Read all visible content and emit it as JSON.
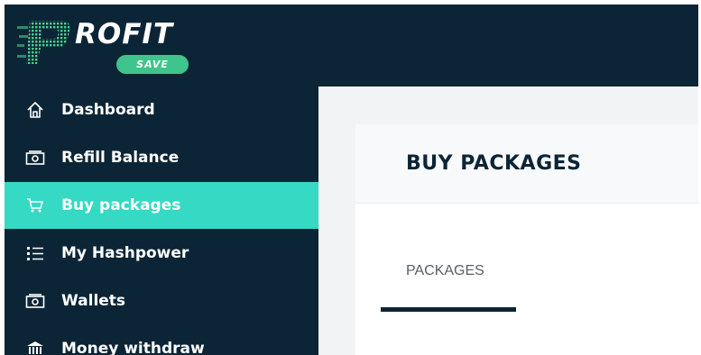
{
  "brand": {
    "name": "ROFIT",
    "sub": "SAVE",
    "colors": {
      "dark": "#0c2536",
      "accent": "#35d9c4",
      "pill": "#3fc48b"
    }
  },
  "sidebar": {
    "items": [
      {
        "label": "Dashboard",
        "icon": "home-icon",
        "active": false
      },
      {
        "label": "Refill Balance",
        "icon": "money-icon",
        "active": false
      },
      {
        "label": "Buy packages",
        "icon": "cart-icon",
        "active": true
      },
      {
        "label": "My Hashpower",
        "icon": "list-icon",
        "active": false
      },
      {
        "label": "Wallets",
        "icon": "wallet-icon",
        "active": false
      },
      {
        "label": "Money withdraw",
        "icon": "bank-icon",
        "active": false
      }
    ]
  },
  "main": {
    "title": "BUY PACKAGES",
    "tabs": [
      {
        "label": "PACKAGES",
        "active": true
      }
    ]
  }
}
